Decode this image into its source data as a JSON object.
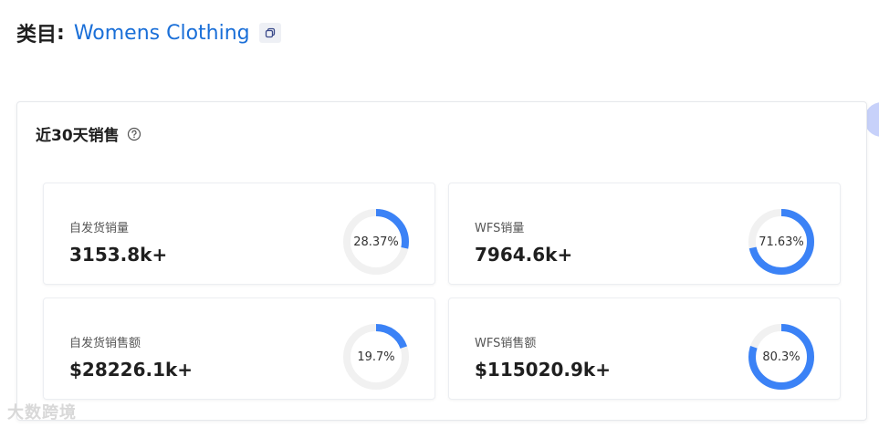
{
  "header": {
    "label": "类目",
    "colon": ":",
    "category": "Womens Clothing"
  },
  "panel": {
    "title": "近30天销售"
  },
  "cards": [
    {
      "label": "自发货销量",
      "value": "3153.8k+",
      "percent_text": "28.37%",
      "percent": 28.37
    },
    {
      "label": "WFS销量",
      "value": "7964.6k+",
      "percent_text": "71.63%",
      "percent": 71.63
    },
    {
      "label": "自发货销售额",
      "value": "$28226.1k+",
      "percent_text": "19.7%",
      "percent": 19.7
    },
    {
      "label": "WFS销售额",
      "value": "$115020.9k+",
      "percent_text": "80.3%",
      "percent": 80.3
    }
  ],
  "watermark": "大数跨境",
  "colors": {
    "accent": "#3b82f6",
    "track": "#f1f1f1",
    "link": "#1a6fd8"
  },
  "icons": {
    "copy": "copy-icon",
    "help": "help-circle-icon"
  }
}
